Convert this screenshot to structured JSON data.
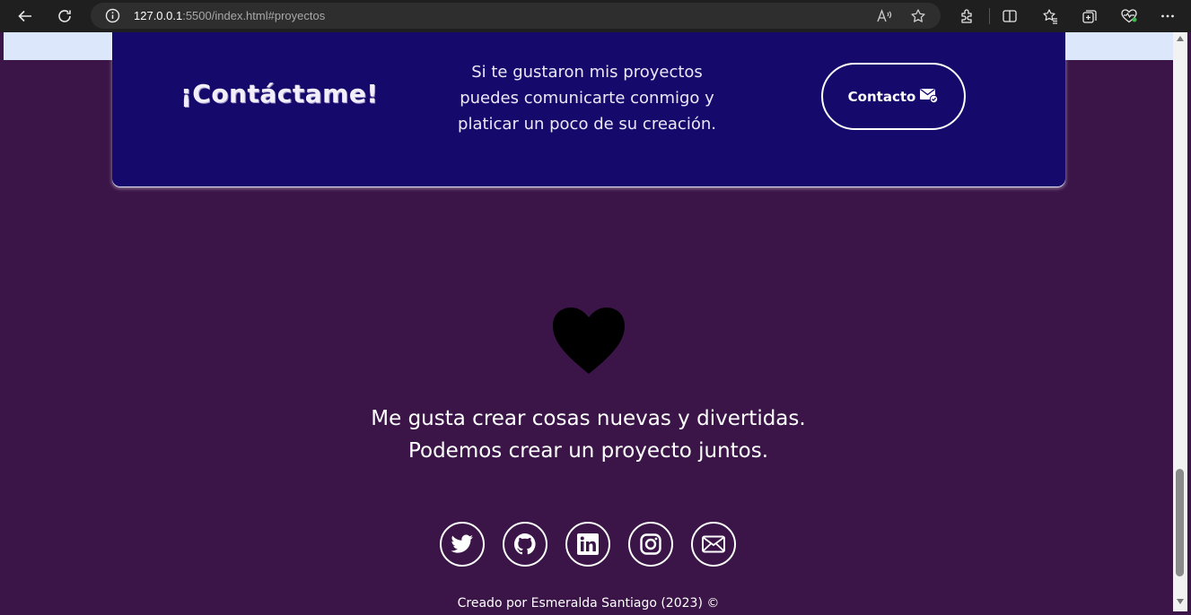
{
  "browser": {
    "url_host": "127.0.0.1",
    "url_rest": ":5500/index.html#proyectos",
    "icons": [
      "back-arrow-icon",
      "refresh-icon",
      "info-icon",
      "read-aloud-icon",
      "star-icon",
      "extensions-icon",
      "split-screen-icon",
      "favorites-icon",
      "collections-icon",
      "health-icon",
      "more-icon"
    ]
  },
  "contact": {
    "title": "¡Contáctame!",
    "text": "Si te gustaron mis proyectos puedes comunicarte conmigo y platicar un poco de su creación.",
    "button_label": "Contacto",
    "button_icon": "mail-check-icon"
  },
  "footer": {
    "heart_icon": "heart-icon",
    "line1": "Me gusta crear cosas nuevas y divertidas.",
    "line2": "Podemos crear un proyecto juntos.",
    "social_icons": [
      "twitter-icon",
      "github-icon",
      "linkedin-icon",
      "instagram-icon",
      "mail-icon"
    ],
    "credit": "Creado por Esmeralda Santiago (2023) ©"
  },
  "colors": {
    "page_bg": "#3b1548",
    "card_bg": "#150a6b",
    "band": "#dde7fb",
    "text": "#ffffff"
  }
}
